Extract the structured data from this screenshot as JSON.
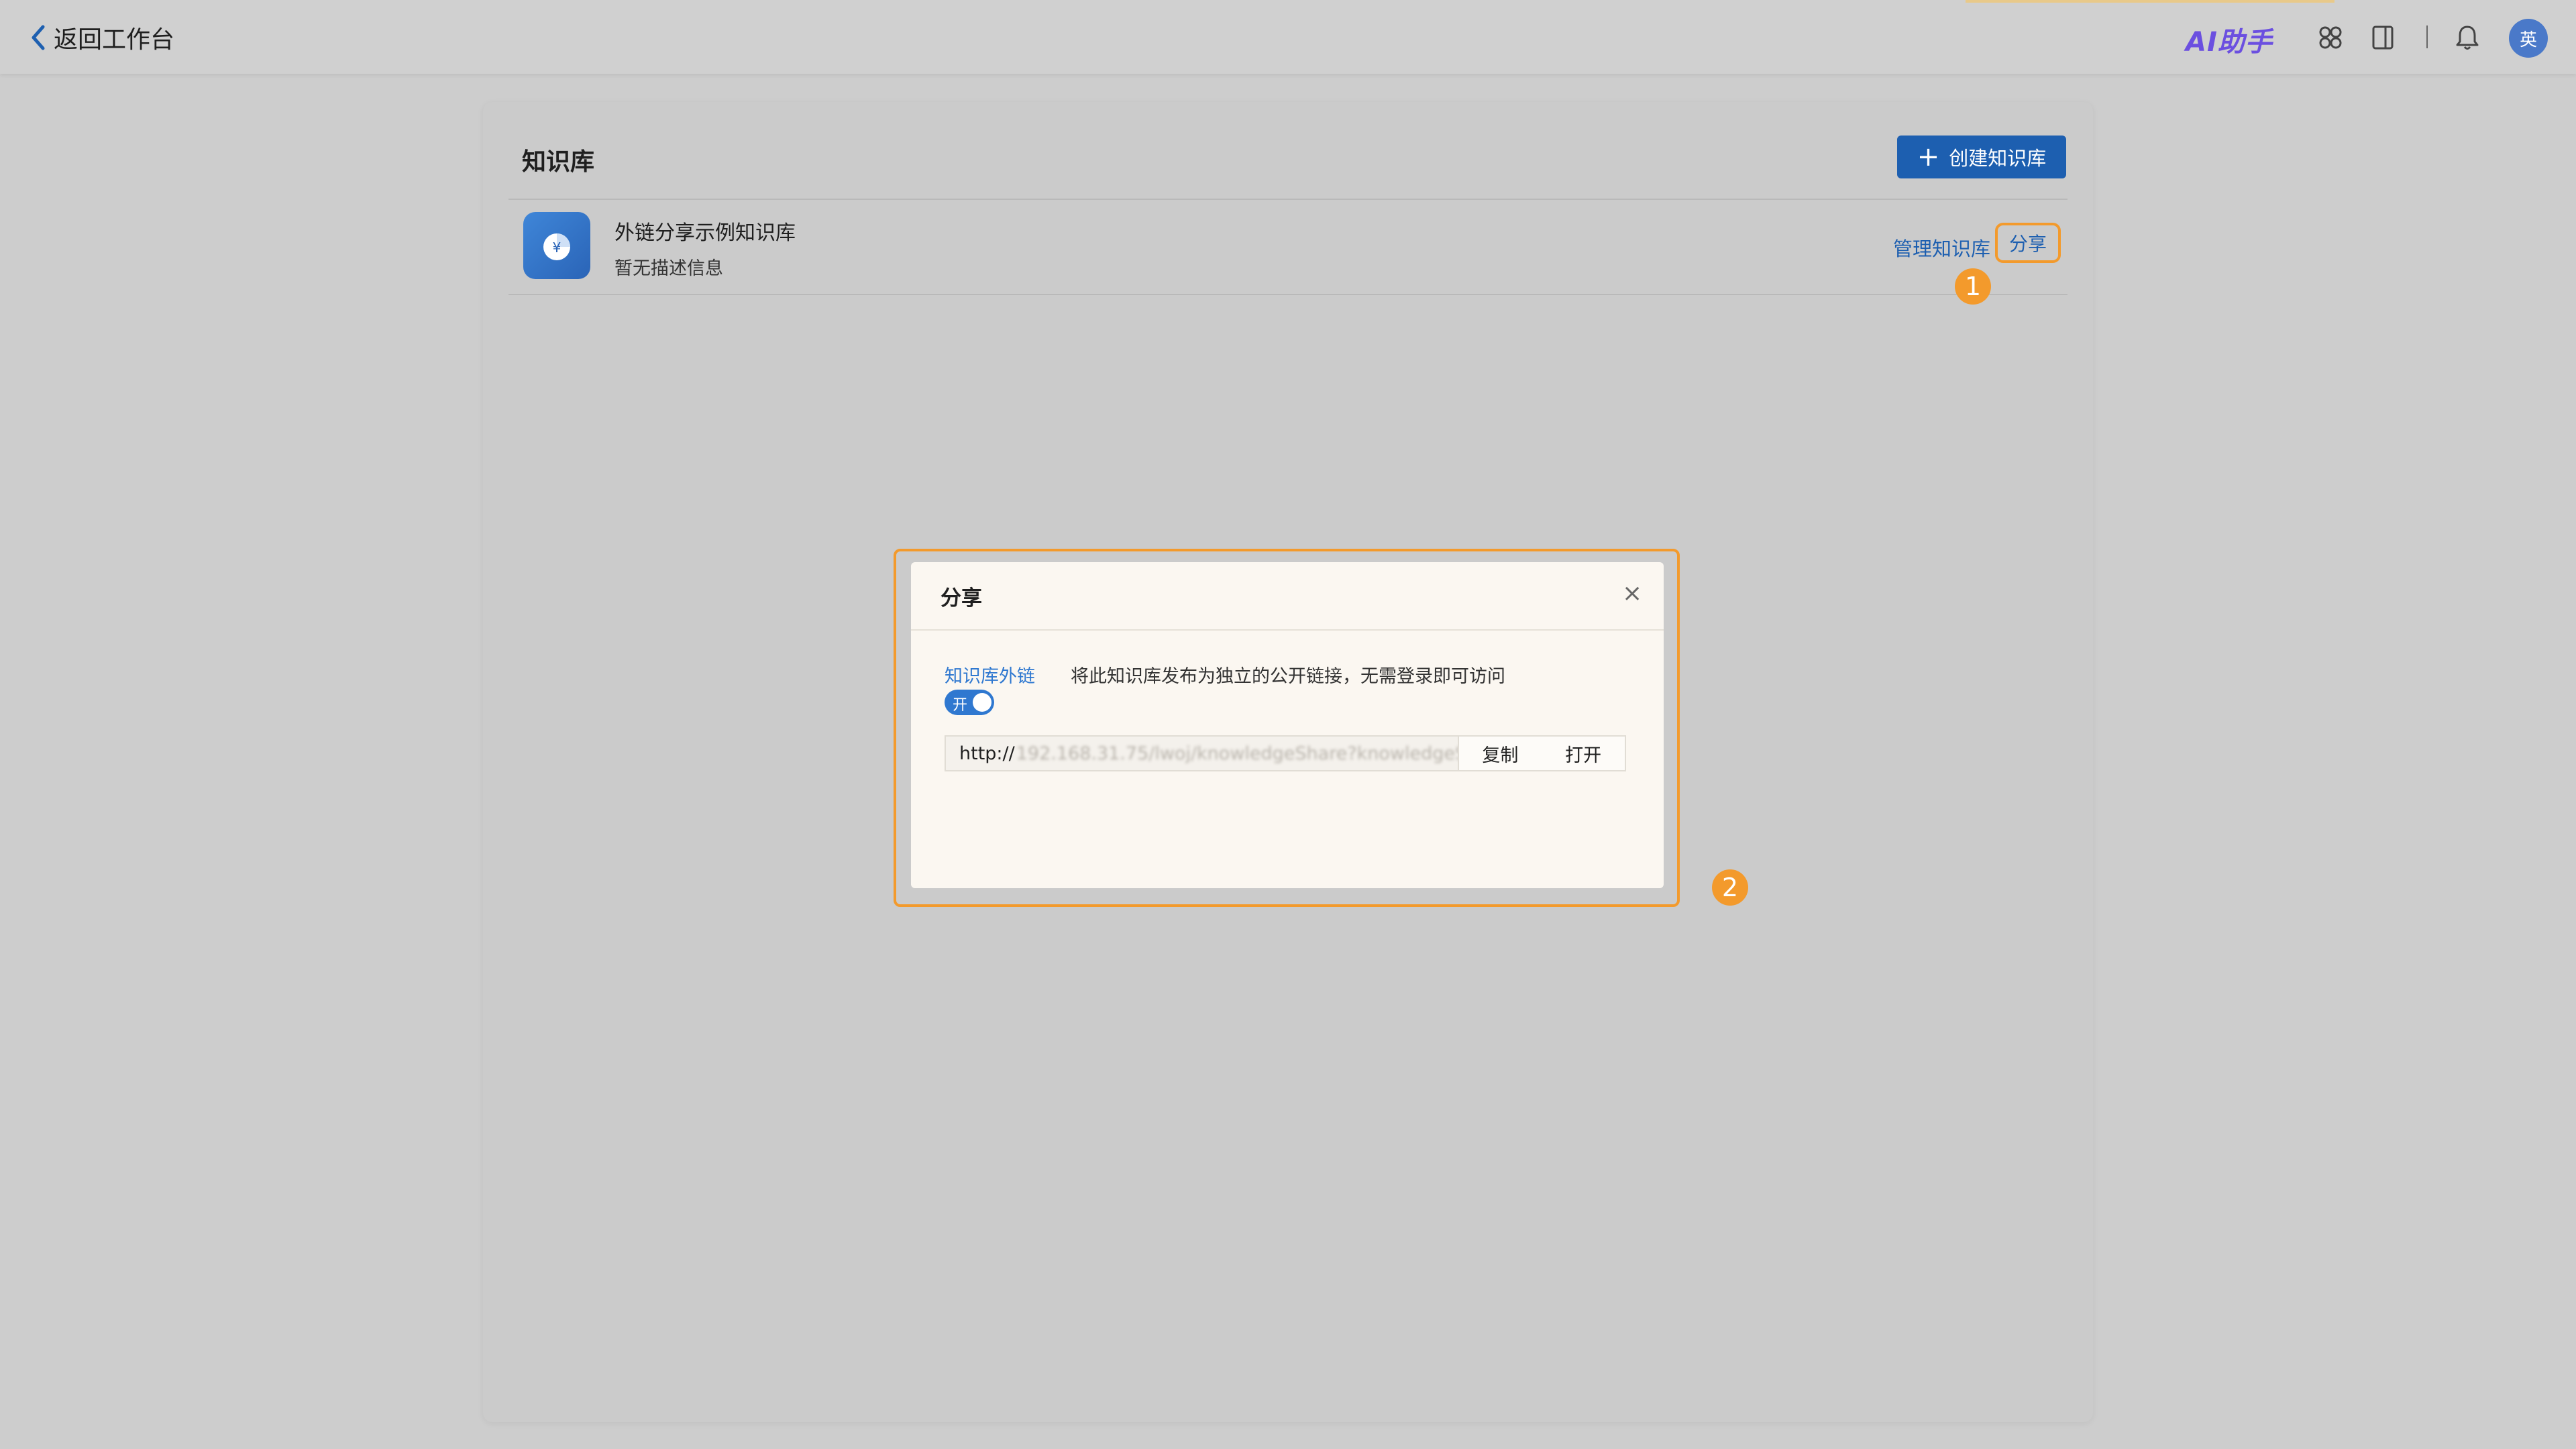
{
  "header": {
    "back_label": "返回工作台",
    "ai_logo": "AI助手",
    "avatar_text": "英",
    "icons": [
      "apps-icon",
      "sidebar-panel-icon",
      "bell-icon"
    ]
  },
  "page": {
    "title": "知识库",
    "create_button": "创建知识库"
  },
  "knowledge_bases": [
    {
      "name": "外链分享示例知识库",
      "description": "暂无描述信息",
      "manage_label": "管理知识库",
      "share_label": "分享"
    }
  ],
  "annotations": {
    "step1": "1",
    "step2": "2",
    "color": "#f39a2c"
  },
  "share_modal": {
    "title": "分享",
    "close": "×",
    "external_link_label": "知识库外链",
    "external_link_desc": "将此知识库发布为独立的公开链接，无需登录即可访问",
    "toggle_text": "开",
    "toggle_on": true,
    "url_prefix": "http://",
    "url_rest": "192.168.31.75/lwoj/knowledgeShare?knowledgeSha...",
    "copy_label": "复制",
    "open_label": "打开"
  },
  "colors": {
    "primary": "#1d5fb0",
    "accent": "#2f78d0",
    "highlight": "#f39a2c"
  }
}
